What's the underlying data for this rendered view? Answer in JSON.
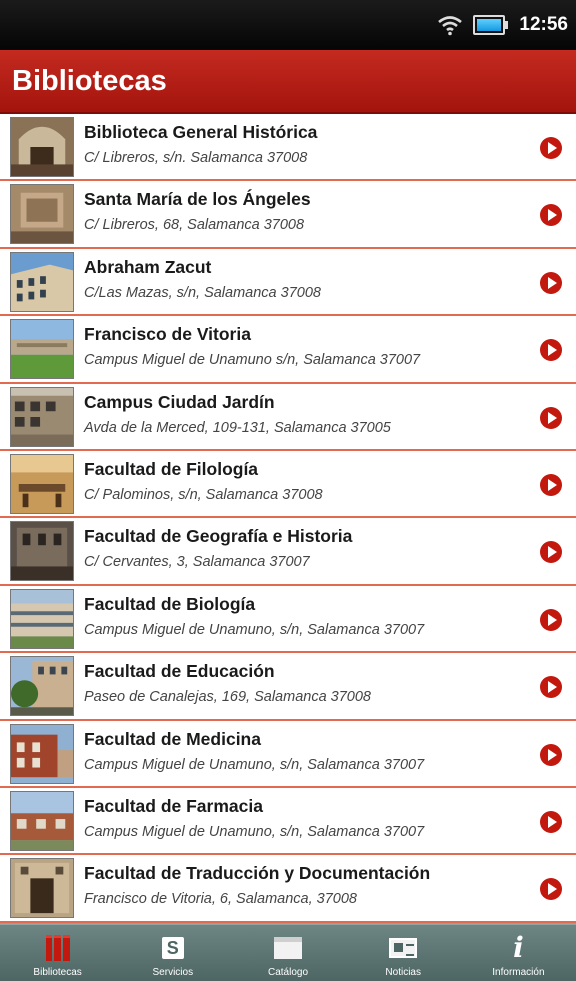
{
  "status_bar": {
    "time": "12:56"
  },
  "header": {
    "title": "Bibliotecas"
  },
  "libraries": [
    {
      "name": "Biblioteca General Histórica",
      "address": "C/ Libreros, s/n. Salamanca 37008",
      "thumb": "interior-hall"
    },
    {
      "name": "Santa María de los Ángeles",
      "address": "C/ Libreros, 68, Salamanca 37008",
      "thumb": "stone-wall"
    },
    {
      "name": "Abraham Zacut",
      "address": "C/Las Mazas, s/n, Salamanca 37008",
      "thumb": "building-sky"
    },
    {
      "name": "Francisco de Vitoria",
      "address": "Campus Miguel de Unamuno s/n, Salamanca 37007",
      "thumb": "campus-lawn"
    },
    {
      "name": "Campus Ciudad Jardín",
      "address": "Avda de la Merced, 109-131, Salamanca 37005",
      "thumb": "modern-building"
    },
    {
      "name": "Facultad de Filología",
      "address": "C/ Palominos, s/n, Salamanca 37008",
      "thumb": "reading-room"
    },
    {
      "name": "Facultad de Geografía e Historia",
      "address": "C/ Cervantes, 3, Salamanca 37007",
      "thumb": "facade-dark"
    },
    {
      "name": "Facultad de Biología",
      "address": "Campus Miguel de Unamuno, s/n, Salamanca 37007",
      "thumb": "long-building"
    },
    {
      "name": "Facultad de Educación",
      "address": "Paseo de Canalejas, 169, Salamanca 37008",
      "thumb": "building-tree"
    },
    {
      "name": "Facultad de Medicina",
      "address": "Campus Miguel de Unamuno, s/n, Salamanca 37007",
      "thumb": "brick-building"
    },
    {
      "name": "Facultad de Farmacia",
      "address": "Campus Miguel de Unamuno, s/n, Salamanca 37007",
      "thumb": "brick-low"
    },
    {
      "name": "Facultad de Traducción y Documentación",
      "address": "Francisco de Vitoria, 6, Salamanca, 37008",
      "thumb": "stone-doorway"
    }
  ],
  "tab_bar": {
    "tabs": [
      {
        "label": "Bibliotecas",
        "icon": "books-icon",
        "active": true
      },
      {
        "label": "Servicios",
        "icon": "servicios-icon",
        "glyph": "S"
      },
      {
        "label": "Catálogo",
        "icon": "catalog-icon"
      },
      {
        "label": "Noticias",
        "icon": "news-icon"
      },
      {
        "label": "Información",
        "icon": "info-icon",
        "glyph": "i"
      }
    ]
  },
  "colors": {
    "header_red": "#b81f16",
    "divider": "#e26a50",
    "arrow_red": "#c2180e",
    "tab_bar": "#5b7472",
    "status_bar": "#0a0a0a"
  }
}
